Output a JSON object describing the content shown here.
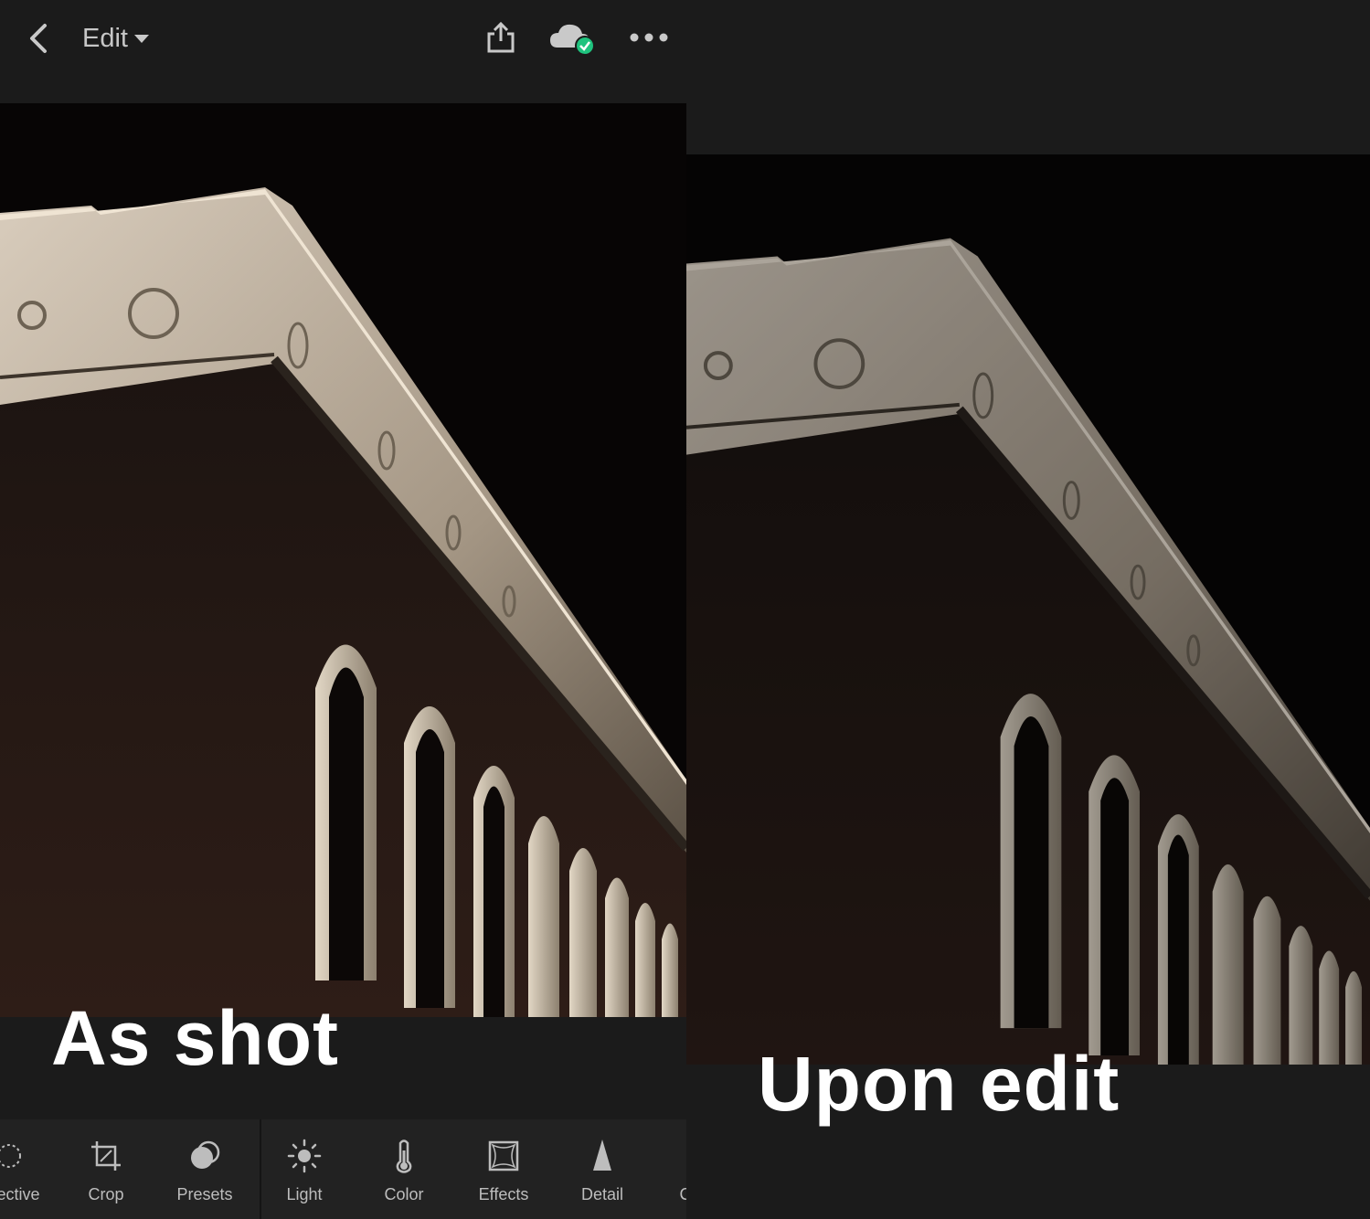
{
  "header": {
    "edit_label": "Edit",
    "sync_status_color": "#1fc37e"
  },
  "captions": {
    "left": "As shot",
    "right": "Upon edit"
  },
  "toolbar": {
    "items": [
      {
        "label": "ective",
        "icon": "selective-icon"
      },
      {
        "label": "Crop",
        "icon": "crop-icon"
      },
      {
        "label": "Presets",
        "icon": "presets-icon"
      },
      {
        "label": "Light",
        "icon": "light-icon"
      },
      {
        "label": "Color",
        "icon": "color-icon"
      },
      {
        "label": "Effects",
        "icon": "effects-icon"
      },
      {
        "label": "Detail",
        "icon": "detail-icon"
      },
      {
        "label": "C",
        "icon": ""
      }
    ]
  },
  "colors": {
    "bg": "#1b1b1b",
    "toolbar_bg": "#222222",
    "label": "#bdbdbd",
    "caption": "#ffffff"
  }
}
